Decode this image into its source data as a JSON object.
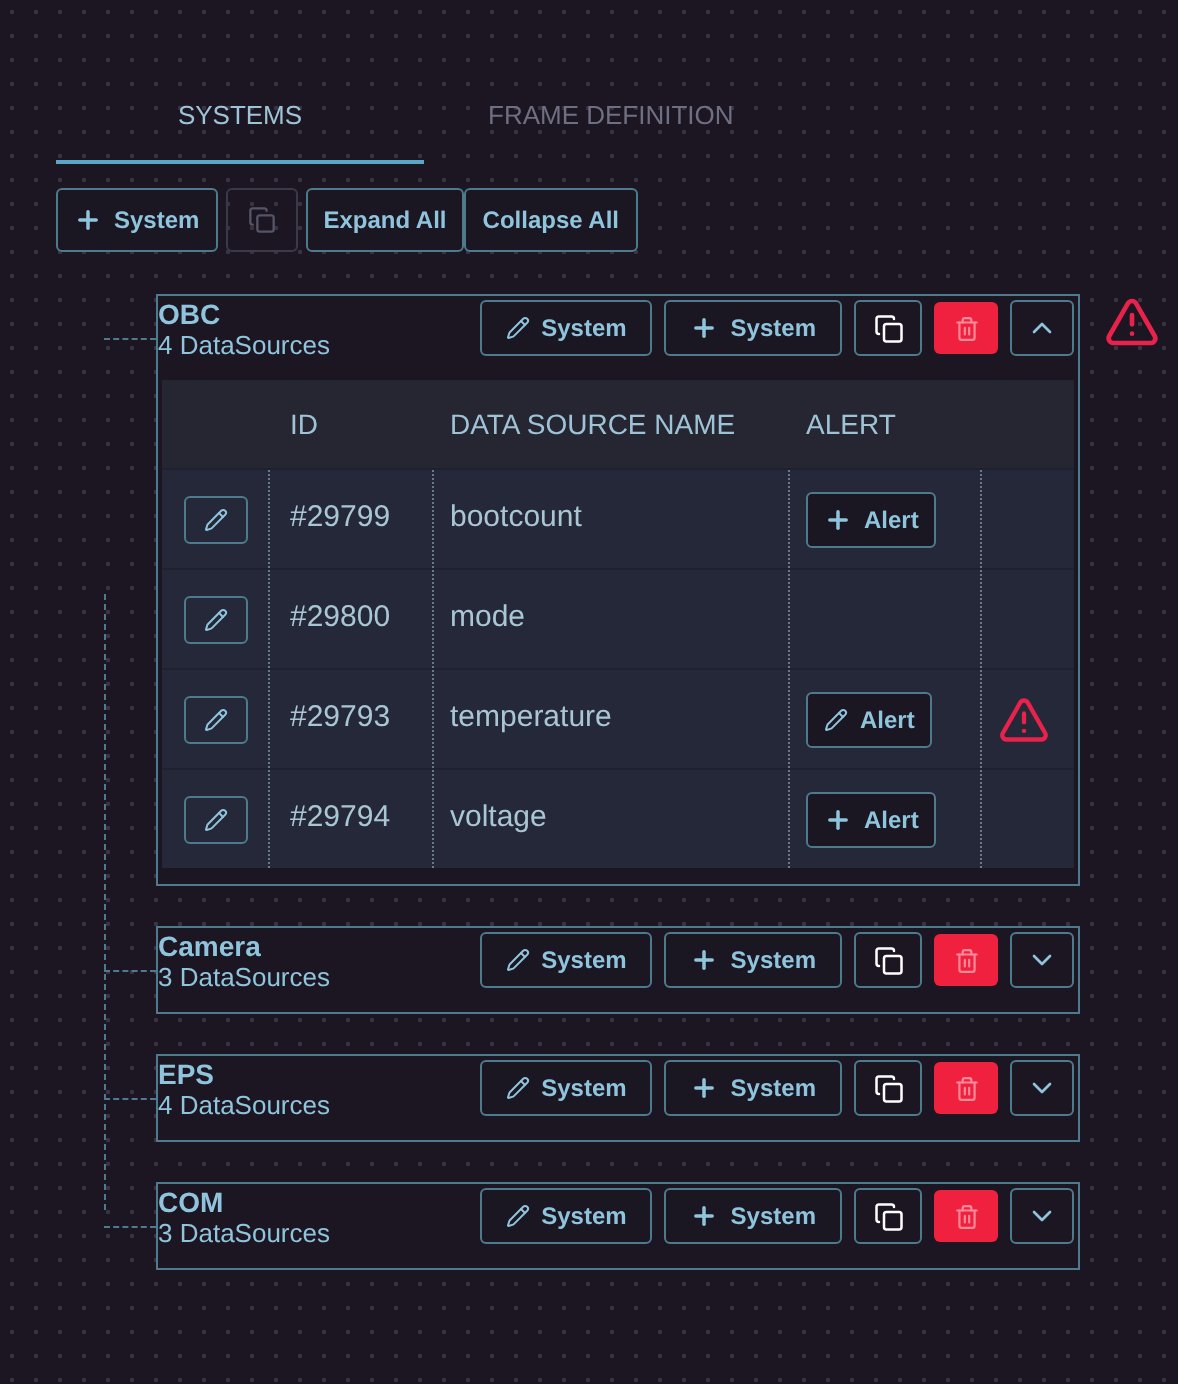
{
  "tabs": [
    {
      "label": "SYSTEMS",
      "selected": true
    },
    {
      "label": "FRAME DEFINITION",
      "selected": false
    }
  ],
  "toolbar": {
    "add_label": "System",
    "copy_disabled": true,
    "expand_label": "Expand All",
    "collapse_label": "Collapse All"
  },
  "table_columns": [
    "ID",
    "DATA SOURCE NAME",
    "ALERT"
  ],
  "systems": [
    {
      "name": "OBC",
      "count": "4 DataSources",
      "expanded": true,
      "warning": true,
      "edit_label": "System",
      "add_label": "System",
      "datasources": [
        {
          "id": "#29799",
          "name": "bootcount",
          "kind": "add",
          "alert_label": "Alert",
          "warning": false
        },
        {
          "id": "#29800",
          "name": "mode",
          "kind": "none",
          "warning": false
        },
        {
          "id": "#29793",
          "name": "temperature",
          "kind": "edit",
          "alert_label": "Alert",
          "warning": true
        },
        {
          "id": "#29794",
          "name": "voltage",
          "kind": "add",
          "alert_label": "Alert",
          "warning": false
        }
      ]
    },
    {
      "name": "Camera",
      "count": "3 DataSources",
      "expanded": false,
      "warning": false,
      "edit_label": "System",
      "add_label": "System"
    },
    {
      "name": "EPS",
      "count": "4 DataSources",
      "expanded": false,
      "warning": false,
      "edit_label": "System",
      "add_label": "System"
    },
    {
      "name": "COM",
      "count": "3 DataSources",
      "expanded": false,
      "warning": false,
      "edit_label": "System",
      "add_label": "System"
    }
  ]
}
